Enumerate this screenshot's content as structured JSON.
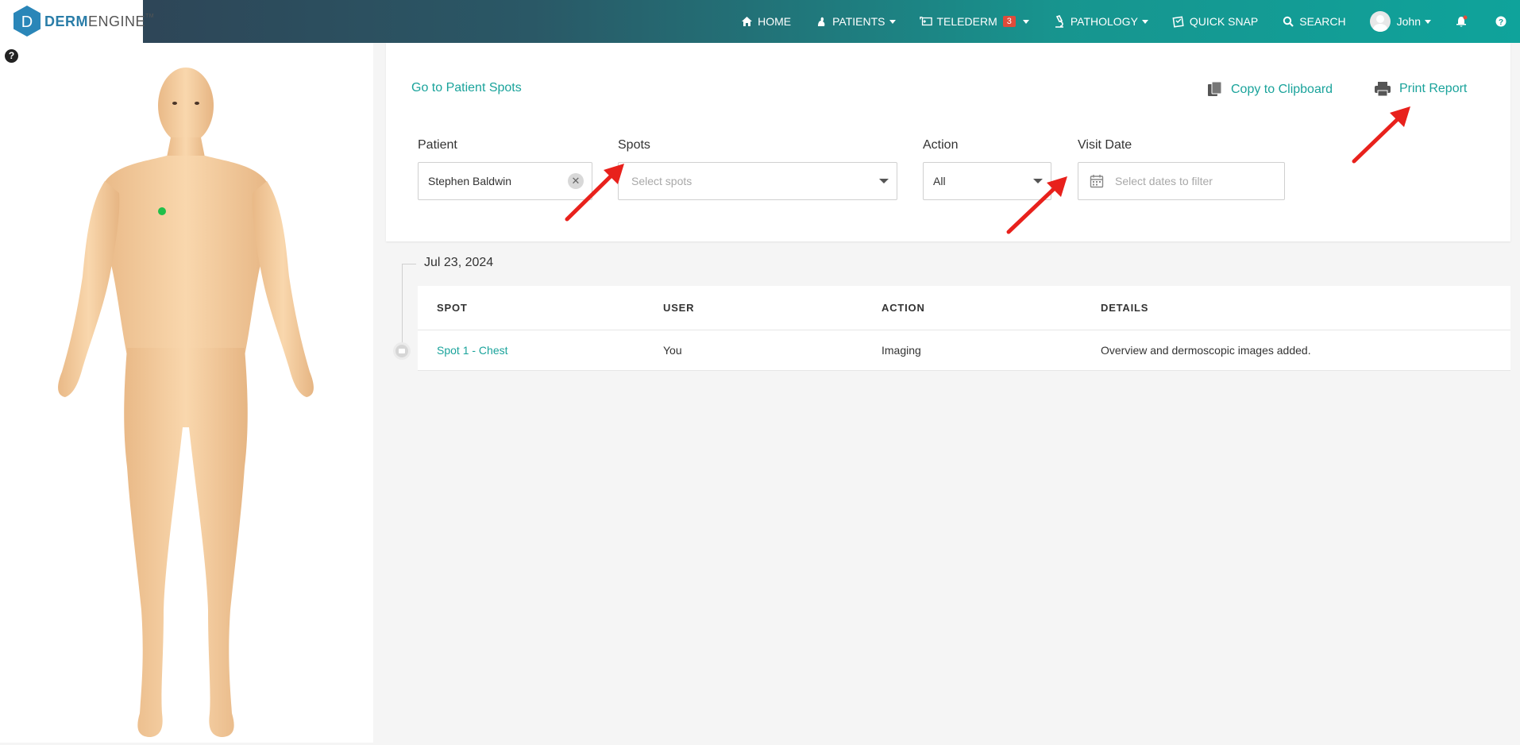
{
  "app": {
    "logo_text_strong": "DERM",
    "logo_text_light": "ENGINE",
    "logo_tm": "TM",
    "logo_letter": "D"
  },
  "nav": {
    "items": [
      {
        "label": "HOME",
        "icon": "home-icon"
      },
      {
        "label": "PATIENTS",
        "icon": "patients-icon",
        "dropdown": true
      },
      {
        "label": "TELEDERM",
        "icon": "telederm-icon",
        "badge": "3",
        "dropdown": true
      },
      {
        "label": "PATHOLOGY",
        "icon": "microscope-icon",
        "dropdown": true
      },
      {
        "label": "QUICK SNAP",
        "icon": "quick-snap-icon"
      },
      {
        "label": "SEARCH",
        "icon": "search-icon"
      }
    ],
    "user": {
      "name": "John",
      "icon": "avatar-icon"
    },
    "notifications_icon": "bell-icon",
    "help_icon": "help-icon"
  },
  "left_panel": {
    "help_symbol": "?",
    "body_map": {
      "icon": "body-map-figure",
      "marker_color": "#1fbf4a"
    }
  },
  "filters": {
    "go_to_spots": "Go to Patient Spots",
    "copy_clipboard": "Copy to Clipboard",
    "print_report": "Print Report",
    "patient": {
      "label": "Patient",
      "value": "Stephen Baldwin"
    },
    "spots": {
      "label": "Spots",
      "placeholder": "Select spots"
    },
    "action": {
      "label": "Action",
      "value": "All"
    },
    "visit_date": {
      "label": "Visit Date",
      "placeholder": "Select dates to filter"
    }
  },
  "timeline": {
    "date": "Jul 23, 2024",
    "columns": [
      "SPOT",
      "USER",
      "ACTION",
      "DETAILS"
    ],
    "rows": [
      {
        "spot": "Spot 1 - Chest",
        "user": "You",
        "action": "Imaging",
        "details": "Overview and dermoscopic images added."
      }
    ]
  },
  "colors": {
    "accent": "#1aa39b",
    "annotation_arrow": "#e8211c",
    "badge": "#e04b3a"
  }
}
